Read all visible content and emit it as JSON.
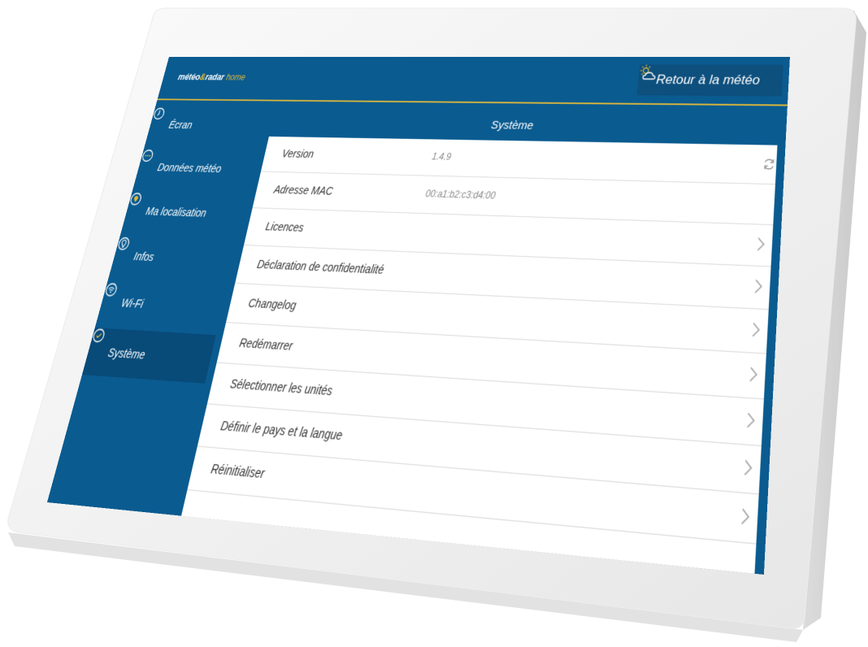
{
  "app": {
    "brand_part1": "météo",
    "brand_amp": "&",
    "brand_part2": "radar",
    "brand_part3": " home",
    "back_label": "Retour à la météo"
  },
  "sidebar": {
    "items": [
      {
        "label": "Écran",
        "icon": "clock-icon",
        "active": false
      },
      {
        "label": "Données météo",
        "icon": "dots-icon",
        "active": false
      },
      {
        "label": "Ma localisation",
        "icon": "location-pin-icon",
        "active": false
      },
      {
        "label": "Infos",
        "icon": "lightbulb-icon",
        "active": false
      },
      {
        "label": "Wi-Fi",
        "icon": "wifi-icon",
        "active": false
      },
      {
        "label": "Système",
        "icon": "check-circle-icon",
        "active": true
      }
    ]
  },
  "panel": {
    "title": "Système",
    "rows": [
      {
        "label": "Version",
        "value": "1.4.9"
      },
      {
        "label": "Adresse MAC",
        "value": "00:a1:b2:c3:d4:00"
      },
      {
        "label": "Licences"
      },
      {
        "label": "Déclaration de confidentialité"
      },
      {
        "label": "Changelog"
      },
      {
        "label": "Redémarrer"
      },
      {
        "label": "Sélectionner les unités"
      },
      {
        "label": "Définir le pays et la langue"
      },
      {
        "label": "Réinitialiser"
      }
    ]
  },
  "colors": {
    "primary_blue": "#0a5b90",
    "active_blue": "#084a78",
    "accent_gold": "#e2b93a"
  }
}
